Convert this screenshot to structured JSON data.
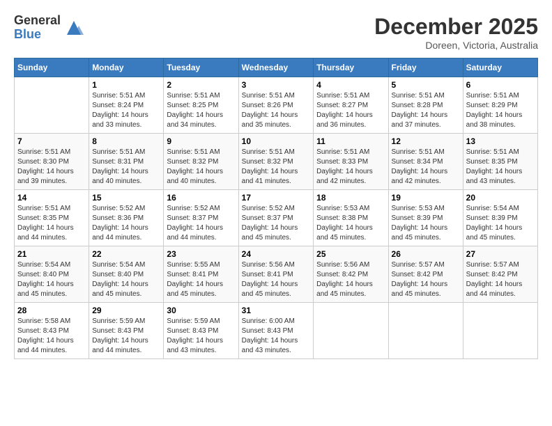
{
  "logo": {
    "general": "General",
    "blue": "Blue"
  },
  "title": {
    "month_year": "December 2025",
    "location": "Doreen, Victoria, Australia"
  },
  "headers": [
    "Sunday",
    "Monday",
    "Tuesday",
    "Wednesday",
    "Thursday",
    "Friday",
    "Saturday"
  ],
  "weeks": [
    [
      {
        "day": "",
        "sunrise": "",
        "sunset": "",
        "daylight": ""
      },
      {
        "day": "1",
        "sunrise": "Sunrise: 5:51 AM",
        "sunset": "Sunset: 8:24 PM",
        "daylight": "Daylight: 14 hours and 33 minutes."
      },
      {
        "day": "2",
        "sunrise": "Sunrise: 5:51 AM",
        "sunset": "Sunset: 8:25 PM",
        "daylight": "Daylight: 14 hours and 34 minutes."
      },
      {
        "day": "3",
        "sunrise": "Sunrise: 5:51 AM",
        "sunset": "Sunset: 8:26 PM",
        "daylight": "Daylight: 14 hours and 35 minutes."
      },
      {
        "day": "4",
        "sunrise": "Sunrise: 5:51 AM",
        "sunset": "Sunset: 8:27 PM",
        "daylight": "Daylight: 14 hours and 36 minutes."
      },
      {
        "day": "5",
        "sunrise": "Sunrise: 5:51 AM",
        "sunset": "Sunset: 8:28 PM",
        "daylight": "Daylight: 14 hours and 37 minutes."
      },
      {
        "day": "6",
        "sunrise": "Sunrise: 5:51 AM",
        "sunset": "Sunset: 8:29 PM",
        "daylight": "Daylight: 14 hours and 38 minutes."
      }
    ],
    [
      {
        "day": "7",
        "sunrise": "Sunrise: 5:51 AM",
        "sunset": "Sunset: 8:30 PM",
        "daylight": "Daylight: 14 hours and 39 minutes."
      },
      {
        "day": "8",
        "sunrise": "Sunrise: 5:51 AM",
        "sunset": "Sunset: 8:31 PM",
        "daylight": "Daylight: 14 hours and 40 minutes."
      },
      {
        "day": "9",
        "sunrise": "Sunrise: 5:51 AM",
        "sunset": "Sunset: 8:32 PM",
        "daylight": "Daylight: 14 hours and 40 minutes."
      },
      {
        "day": "10",
        "sunrise": "Sunrise: 5:51 AM",
        "sunset": "Sunset: 8:32 PM",
        "daylight": "Daylight: 14 hours and 41 minutes."
      },
      {
        "day": "11",
        "sunrise": "Sunrise: 5:51 AM",
        "sunset": "Sunset: 8:33 PM",
        "daylight": "Daylight: 14 hours and 42 minutes."
      },
      {
        "day": "12",
        "sunrise": "Sunrise: 5:51 AM",
        "sunset": "Sunset: 8:34 PM",
        "daylight": "Daylight: 14 hours and 42 minutes."
      },
      {
        "day": "13",
        "sunrise": "Sunrise: 5:51 AM",
        "sunset": "Sunset: 8:35 PM",
        "daylight": "Daylight: 14 hours and 43 minutes."
      }
    ],
    [
      {
        "day": "14",
        "sunrise": "Sunrise: 5:51 AM",
        "sunset": "Sunset: 8:35 PM",
        "daylight": "Daylight: 14 hours and 44 minutes."
      },
      {
        "day": "15",
        "sunrise": "Sunrise: 5:52 AM",
        "sunset": "Sunset: 8:36 PM",
        "daylight": "Daylight: 14 hours and 44 minutes."
      },
      {
        "day": "16",
        "sunrise": "Sunrise: 5:52 AM",
        "sunset": "Sunset: 8:37 PM",
        "daylight": "Daylight: 14 hours and 44 minutes."
      },
      {
        "day": "17",
        "sunrise": "Sunrise: 5:52 AM",
        "sunset": "Sunset: 8:37 PM",
        "daylight": "Daylight: 14 hours and 45 minutes."
      },
      {
        "day": "18",
        "sunrise": "Sunrise: 5:53 AM",
        "sunset": "Sunset: 8:38 PM",
        "daylight": "Daylight: 14 hours and 45 minutes."
      },
      {
        "day": "19",
        "sunrise": "Sunrise: 5:53 AM",
        "sunset": "Sunset: 8:39 PM",
        "daylight": "Daylight: 14 hours and 45 minutes."
      },
      {
        "day": "20",
        "sunrise": "Sunrise: 5:54 AM",
        "sunset": "Sunset: 8:39 PM",
        "daylight": "Daylight: 14 hours and 45 minutes."
      }
    ],
    [
      {
        "day": "21",
        "sunrise": "Sunrise: 5:54 AM",
        "sunset": "Sunset: 8:40 PM",
        "daylight": "Daylight: 14 hours and 45 minutes."
      },
      {
        "day": "22",
        "sunrise": "Sunrise: 5:54 AM",
        "sunset": "Sunset: 8:40 PM",
        "daylight": "Daylight: 14 hours and 45 minutes."
      },
      {
        "day": "23",
        "sunrise": "Sunrise: 5:55 AM",
        "sunset": "Sunset: 8:41 PM",
        "daylight": "Daylight: 14 hours and 45 minutes."
      },
      {
        "day": "24",
        "sunrise": "Sunrise: 5:56 AM",
        "sunset": "Sunset: 8:41 PM",
        "daylight": "Daylight: 14 hours and 45 minutes."
      },
      {
        "day": "25",
        "sunrise": "Sunrise: 5:56 AM",
        "sunset": "Sunset: 8:42 PM",
        "daylight": "Daylight: 14 hours and 45 minutes."
      },
      {
        "day": "26",
        "sunrise": "Sunrise: 5:57 AM",
        "sunset": "Sunset: 8:42 PM",
        "daylight": "Daylight: 14 hours and 45 minutes."
      },
      {
        "day": "27",
        "sunrise": "Sunrise: 5:57 AM",
        "sunset": "Sunset: 8:42 PM",
        "daylight": "Daylight: 14 hours and 44 minutes."
      }
    ],
    [
      {
        "day": "28",
        "sunrise": "Sunrise: 5:58 AM",
        "sunset": "Sunset: 8:43 PM",
        "daylight": "Daylight: 14 hours and 44 minutes."
      },
      {
        "day": "29",
        "sunrise": "Sunrise: 5:59 AM",
        "sunset": "Sunset: 8:43 PM",
        "daylight": "Daylight: 14 hours and 44 minutes."
      },
      {
        "day": "30",
        "sunrise": "Sunrise: 5:59 AM",
        "sunset": "Sunset: 8:43 PM",
        "daylight": "Daylight: 14 hours and 43 minutes."
      },
      {
        "day": "31",
        "sunrise": "Sunrise: 6:00 AM",
        "sunset": "Sunset: 8:43 PM",
        "daylight": "Daylight: 14 hours and 43 minutes."
      },
      {
        "day": "",
        "sunrise": "",
        "sunset": "",
        "daylight": ""
      },
      {
        "day": "",
        "sunrise": "",
        "sunset": "",
        "daylight": ""
      },
      {
        "day": "",
        "sunrise": "",
        "sunset": "",
        "daylight": ""
      }
    ]
  ]
}
